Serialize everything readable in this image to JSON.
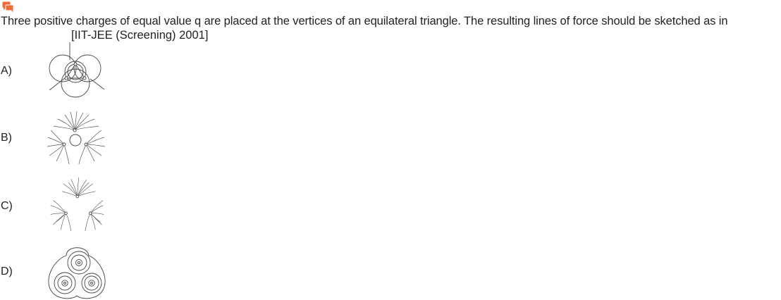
{
  "question": {
    "text": "Three positive charges of equal value q are placed at the vertices of an equilateral triangle. The resulting lines of force should be sketched as in",
    "source": "[IIT-JEE (Screening) 2001]"
  },
  "options": [
    {
      "label": "A)"
    },
    {
      "label": "B)"
    },
    {
      "label": "C)"
    },
    {
      "label": "D)"
    }
  ],
  "colors": {
    "icon": "#f26a36",
    "text": "#222222",
    "figure_stroke": "#444444"
  },
  "icons": {
    "question_icon": "chat-bubble-icon"
  }
}
